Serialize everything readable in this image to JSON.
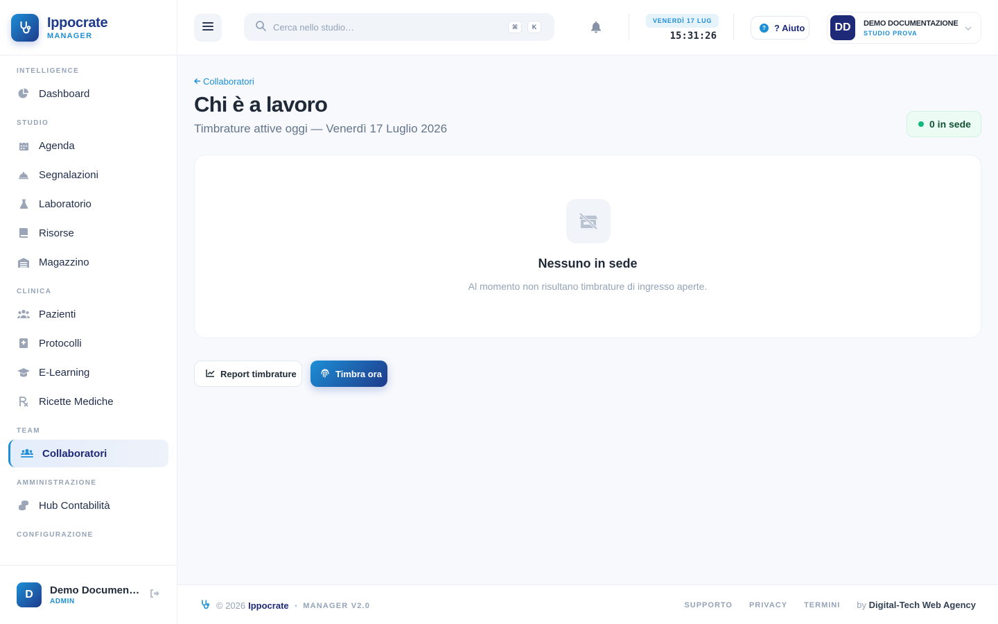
{
  "brand": {
    "name": "Ippocrate",
    "subtitle": "MANAGER"
  },
  "sidebar": {
    "sections": [
      {
        "title": "INTELLIGENCE",
        "items": [
          {
            "label": "Dashboard",
            "icon": "pie-chart-icon"
          }
        ]
      },
      {
        "title": "STUDIO",
        "items": [
          {
            "label": "Agenda",
            "icon": "calendar-icon"
          },
          {
            "label": "Segnalazioni",
            "icon": "bell-service-icon"
          },
          {
            "label": "Laboratorio",
            "icon": "flask-icon"
          },
          {
            "label": "Risorse",
            "icon": "book-icon"
          },
          {
            "label": "Magazzino",
            "icon": "warehouse-icon"
          }
        ]
      },
      {
        "title": "CLINICA",
        "items": [
          {
            "label": "Pazienti",
            "icon": "users-icon"
          },
          {
            "label": "Protocolli",
            "icon": "file-medical-icon"
          },
          {
            "label": "E-Learning",
            "icon": "graduation-cap-icon"
          },
          {
            "label": "Ricette Mediche",
            "icon": "prescription-icon"
          }
        ]
      },
      {
        "title": "TEAM",
        "items": [
          {
            "label": "Collaboratori",
            "icon": "team-icon",
            "active": true
          }
        ]
      },
      {
        "title": "AMMINISTRAZIONE",
        "items": [
          {
            "label": "Hub Contabilità",
            "icon": "coins-icon"
          }
        ]
      },
      {
        "title": "CONFIGURAZIONE",
        "items": []
      }
    ],
    "user": {
      "initial": "D",
      "name": "Demo Documentazione",
      "role": "ADMIN"
    }
  },
  "header": {
    "search_placeholder": "Cerca nello studio…",
    "kbd_cmd": "⌘",
    "kbd_k": "K",
    "date": "VENERDÌ 17 LUG",
    "time": "15:31:26",
    "help_label": "? Aiuto",
    "profile": {
      "initials": "DD",
      "name": "DEMO DOCUMENTAZIONE",
      "org": "STUDIO PROVA"
    }
  },
  "main": {
    "back_label": "Collaboratori",
    "title": "Chi è a lavoro",
    "subtitle": "Timbrature attive oggi — Venerdì 17 Luglio 2026",
    "status_label": "0 in sede",
    "empty_title": "Nessuno in sede",
    "empty_desc": "Al momento non risultano timbrature di ingresso aperte.",
    "report_button": "Report timbrature",
    "timbra_button": "Timbra ora"
  },
  "footer": {
    "copyright": "© 2026",
    "brand": "Ippocrate",
    "version": "MANAGER V2.0",
    "links": [
      "SUPPORTO",
      "PRIVACY",
      "TERMINI"
    ],
    "by_label": "by",
    "agency": "Digital-Tech Web Agency"
  },
  "colors": {
    "accent": "#1d8fd6",
    "brand_dark": "#1e3a8a",
    "success": "#10b981"
  }
}
